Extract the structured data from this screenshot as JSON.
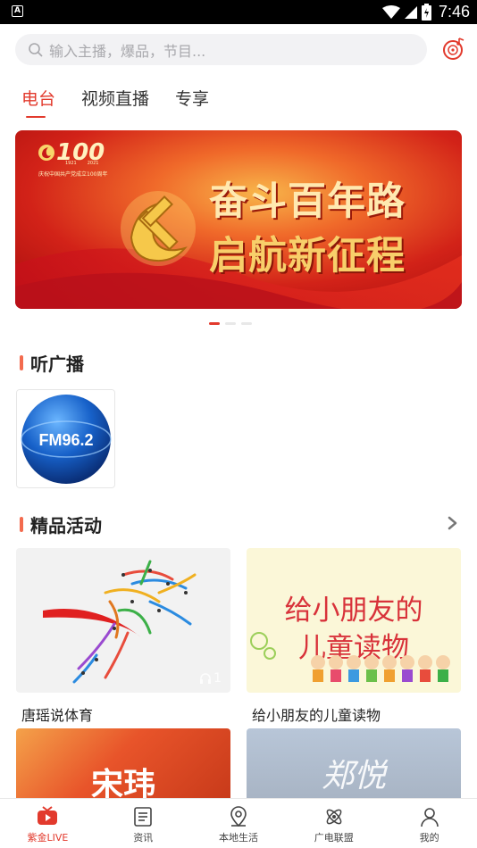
{
  "status_bar": {
    "app_indicator": "A",
    "time": "7:46"
  },
  "search": {
    "placeholder": "输入主播，爆品，节目..."
  },
  "tabs": [
    {
      "label": "电台",
      "active": true
    },
    {
      "label": "视频直播",
      "active": false
    },
    {
      "label": "专享",
      "active": false
    }
  ],
  "banner": {
    "logo_text": "100",
    "logo_years": [
      "1921",
      "2021"
    ],
    "logo_caption": "庆祝中国共产党成立100周年",
    "line1": "奋斗百年路",
    "line2": "启航新征程",
    "dot_count": 3,
    "active_dot": 0
  },
  "listen_section": {
    "title": "听广播",
    "stations": [
      {
        "logo_text": "FM96.2"
      }
    ]
  },
  "activities_section": {
    "title": "精品活动",
    "items": [
      {
        "label": "唐瑶说体育",
        "play_count": "1"
      },
      {
        "label": "给小朋友的儿童读物",
        "image_text": [
          "给小朋友的",
          "儿童读物"
        ]
      }
    ],
    "more_items": [
      {
        "image_text": "宋玮"
      },
      {
        "image_text": "郑悦"
      }
    ]
  },
  "bottom_nav": [
    {
      "label": "紫金LIVE",
      "icon": "tv-play-icon",
      "active": true
    },
    {
      "label": "资讯",
      "icon": "news-icon",
      "active": false
    },
    {
      "label": "本地生活",
      "icon": "location-icon",
      "active": false
    },
    {
      "label": "广电联盟",
      "icon": "atom-icon",
      "active": false
    },
    {
      "label": "我的",
      "icon": "user-icon",
      "active": false
    }
  ],
  "colors": {
    "accent": "#e23a2d",
    "section_bar": "#f36b4e",
    "search_bg": "#f2f2f4"
  }
}
